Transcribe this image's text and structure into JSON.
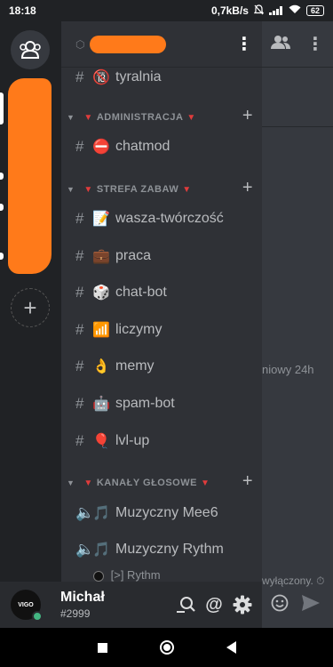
{
  "status_bar": {
    "time": "18:18",
    "speed": "0,7kB/s",
    "battery": "62"
  },
  "server": {
    "menu_icon": "kebab-icon"
  },
  "channels": [
    {
      "name": "tyralnia",
      "emoji": "🔞",
      "locked": true
    },
    {
      "name": "chatmod",
      "emoji": "⛔",
      "locked": true
    },
    {
      "name": "wasza-twórczość",
      "emoji": "📝"
    },
    {
      "name": "praca",
      "emoji": "💼"
    },
    {
      "name": "chat-bot",
      "emoji": "🎲"
    },
    {
      "name": "liczymy",
      "emoji": "📶"
    },
    {
      "name": "memy",
      "emoji": "👌"
    },
    {
      "name": "spam-bot",
      "emoji": "🤖"
    },
    {
      "name": "lvl-up",
      "emoji": "🎈"
    }
  ],
  "categories": {
    "admin": "ADMINISTRACJA",
    "zabawy": "STREFA ZABAW",
    "glosowe": "KANAŁY GŁOSOWE"
  },
  "voice_channels": [
    {
      "name": "Muzyczny Mee6",
      "emoji": "🎵"
    },
    {
      "name": "Muzyczny Rythm",
      "emoji": "🎵"
    }
  ],
  "voice_member": "[>] Rythm",
  "user": {
    "name": "Michał",
    "tag": "#2999",
    "avatar_text": "VIGO"
  },
  "chat_fragments": {
    "line1": "niowy 24h",
    "line2": "wyłączony. ⏱"
  },
  "colors": {
    "accent_red": "#e03c3c",
    "online": "#43b581",
    "redaction": "#ff7a1a"
  }
}
